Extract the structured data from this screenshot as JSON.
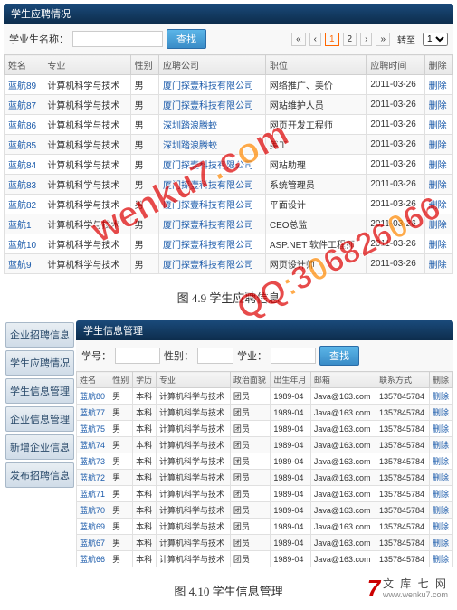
{
  "section1": {
    "titlebar": "学生应聘情况",
    "search_label": "学业生名称：",
    "search_btn": "查找",
    "pager_goto": "转至",
    "caption": "图 4.9  学生应聘信息",
    "headers": [
      "姓名",
      "专业",
      "性别",
      "应聘公司",
      "职位",
      "应聘时间",
      "删除"
    ],
    "rows": [
      {
        "name": "蓝航89",
        "major": "计算机科学与技术",
        "sex": "男",
        "company": "厦门探壹科技有限公司",
        "post": "网络推广、美价",
        "time": "2011-03-26",
        "del": "删除"
      },
      {
        "name": "蓝航87",
        "major": "计算机科学与技术",
        "sex": "男",
        "company": "厦门探壹科技有限公司",
        "post": "网站维护人员",
        "time": "2011-03-26",
        "del": "删除"
      },
      {
        "name": "蓝航86",
        "major": "计算机科学与技术",
        "sex": "男",
        "company": "深圳踏浪腾蛟",
        "post": "网页开发工程师",
        "time": "2011-03-26",
        "del": "删除"
      },
      {
        "name": "蓝航85",
        "major": "计算机科学与技术",
        "sex": "男",
        "company": "深圳踏浪腾蛟",
        "post": "美工",
        "time": "2011-03-26",
        "del": "删除"
      },
      {
        "name": "蓝航84",
        "major": "计算机科学与技术",
        "sex": "男",
        "company": "厦门探壹科技有限公司",
        "post": "网站助理",
        "time": "2011-03-26",
        "del": "删除"
      },
      {
        "name": "蓝航83",
        "major": "计算机科学与技术",
        "sex": "男",
        "company": "厦门探壹科技有限公司",
        "post": "系统管理员",
        "time": "2011-03-26",
        "del": "删除"
      },
      {
        "name": "蓝航82",
        "major": "计算机科学与技术",
        "sex": "男",
        "company": "厦门探壹科技有限公司",
        "post": "平面设计",
        "time": "2011-03-26",
        "del": "删除"
      },
      {
        "name": "蓝航1",
        "major": "计算机科学与技术",
        "sex": "男",
        "company": "厦门探壹科技有限公司",
        "post": "CEO总监",
        "time": "2011-03-26",
        "del": "删除"
      },
      {
        "name": "蓝航10",
        "major": "计算机科学与技术",
        "sex": "男",
        "company": "厦门探壹科技有限公司",
        "post": "ASP.NET 软件工程师",
        "time": "2011-03-26",
        "del": "删除"
      },
      {
        "name": "蓝航9",
        "major": "计算机科学与技术",
        "sex": "男",
        "company": "厦门探壹科技有限公司",
        "post": "网页设计师",
        "time": "2011-03-26",
        "del": "删除"
      }
    ]
  },
  "section2": {
    "titlebar": "学生信息管理",
    "sidebar": [
      "企业招聘信息",
      "学生应聘情况",
      "学生信息管理",
      "企业信息管理",
      "新增企业信息",
      "发布招聘信息"
    ],
    "search_label1": "学号：",
    "search_label2": "性别：",
    "search_label3": "学业：",
    "search_btn": "查找",
    "caption": "图 4.10  学生信息管理",
    "headers": [
      "姓名",
      "性别",
      "学历",
      "专业",
      "政治面貌",
      "出生年月",
      "邮箱",
      "联系方式",
      "删除"
    ],
    "rows": [
      {
        "name": "蓝航80",
        "sex": "男",
        "edu": "本科",
        "major": "计算机科学与技术",
        "pol": "团员",
        "birth": "1989-04",
        "mail": "Java@163.com",
        "tel": "1357845784",
        "del": "删除"
      },
      {
        "name": "蓝航77",
        "sex": "男",
        "edu": "本科",
        "major": "计算机科学与技术",
        "pol": "团员",
        "birth": "1989-04",
        "mail": "Java@163.com",
        "tel": "1357845784",
        "del": "删除"
      },
      {
        "name": "蓝航75",
        "sex": "男",
        "edu": "本科",
        "major": "计算机科学与技术",
        "pol": "团员",
        "birth": "1989-04",
        "mail": "Java@163.com",
        "tel": "1357845784",
        "del": "删除"
      },
      {
        "name": "蓝航74",
        "sex": "男",
        "edu": "本科",
        "major": "计算机科学与技术",
        "pol": "团员",
        "birth": "1989-04",
        "mail": "Java@163.com",
        "tel": "1357845784",
        "del": "删除"
      },
      {
        "name": "蓝航73",
        "sex": "男",
        "edu": "本科",
        "major": "计算机科学与技术",
        "pol": "团员",
        "birth": "1989-04",
        "mail": "Java@163.com",
        "tel": "1357845784",
        "del": "删除"
      },
      {
        "name": "蓝航72",
        "sex": "男",
        "edu": "本科",
        "major": "计算机科学与技术",
        "pol": "团员",
        "birth": "1989-04",
        "mail": "Java@163.com",
        "tel": "1357845784",
        "del": "删除"
      },
      {
        "name": "蓝航71",
        "sex": "男",
        "edu": "本科",
        "major": "计算机科学与技术",
        "pol": "团员",
        "birth": "1989-04",
        "mail": "Java@163.com",
        "tel": "1357845784",
        "del": "删除"
      },
      {
        "name": "蓝航70",
        "sex": "男",
        "edu": "本科",
        "major": "计算机科学与技术",
        "pol": "团员",
        "birth": "1989-04",
        "mail": "Java@163.com",
        "tel": "1357845784",
        "del": "删除"
      },
      {
        "name": "蓝航69",
        "sex": "男",
        "edu": "本科",
        "major": "计算机科学与技术",
        "pol": "团员",
        "birth": "1989-04",
        "mail": "Java@163.com",
        "tel": "1357845784",
        "del": "删除"
      },
      {
        "name": "蓝航67",
        "sex": "男",
        "edu": "本科",
        "major": "计算机科学与技术",
        "pol": "团员",
        "birth": "1989-04",
        "mail": "Java@163.com",
        "tel": "1357845784",
        "del": "删除"
      },
      {
        "name": "蓝航66",
        "sex": "男",
        "edu": "本科",
        "major": "计算机科学与技术",
        "pol": "团员",
        "birth": "1989-04",
        "mail": "Java@163.com",
        "tel": "1357845784",
        "del": "删除"
      }
    ]
  },
  "watermark1": "wenku7.com",
  "watermark2": "QQ:306826066",
  "footer": {
    "brand": "文 库 七 网",
    "url": "www.wenku7.com"
  }
}
